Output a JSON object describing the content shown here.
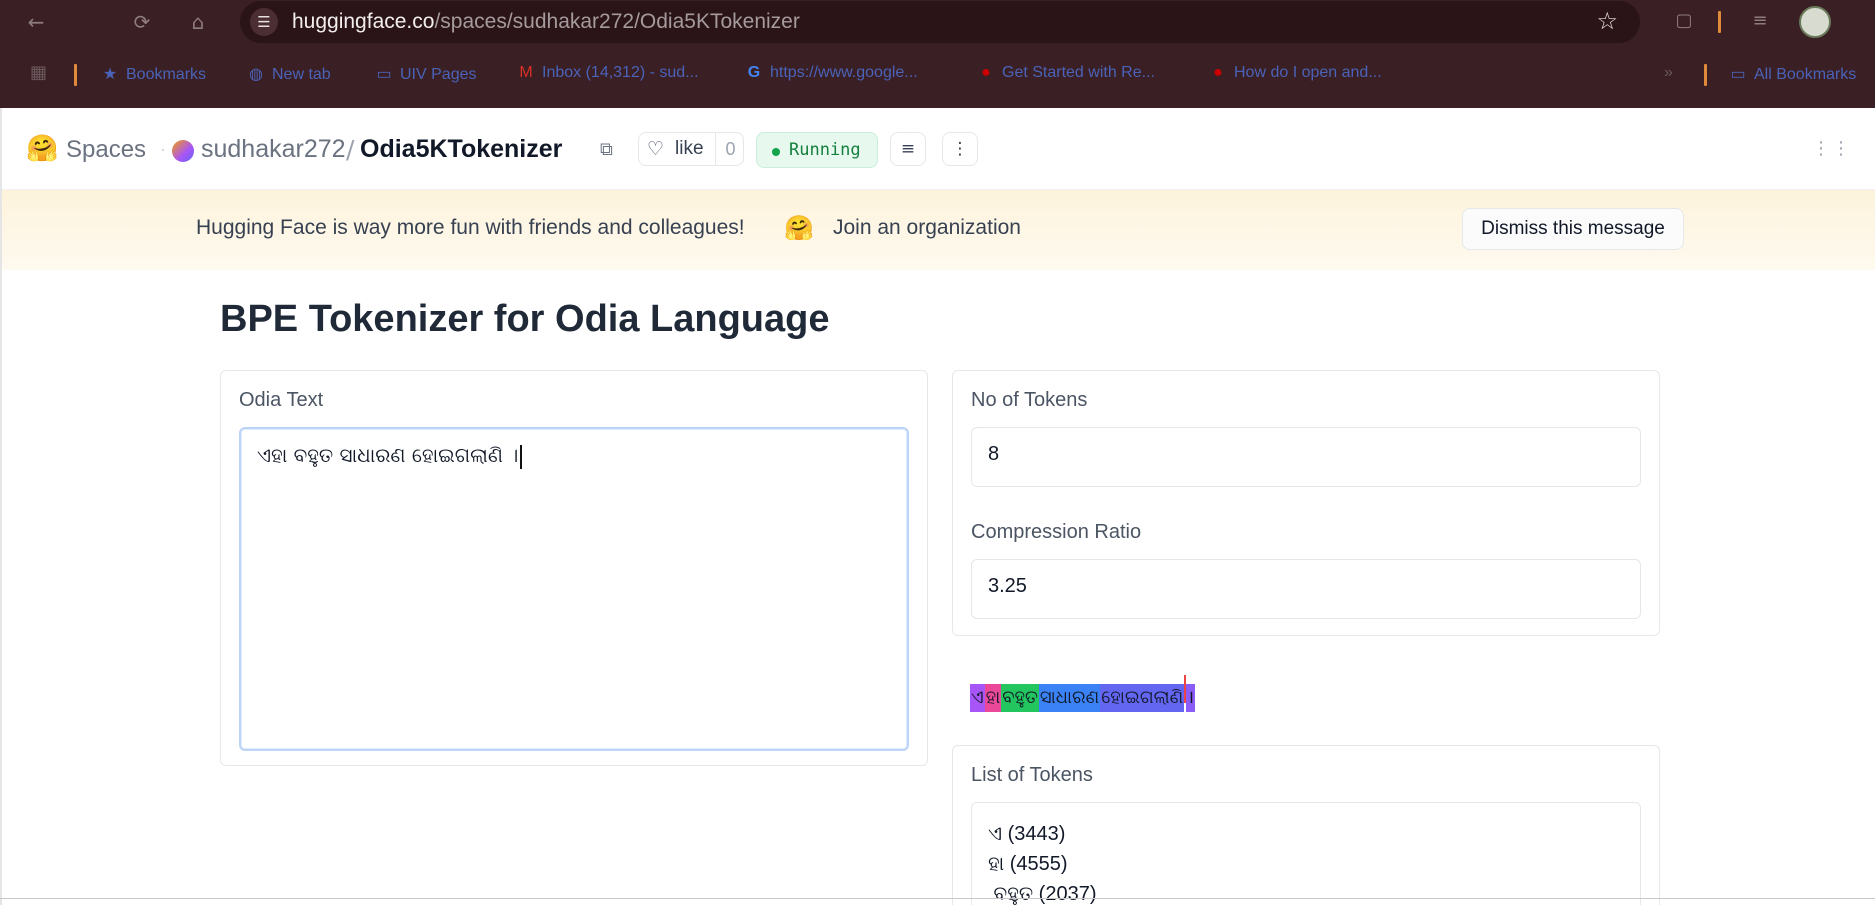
{
  "browser": {
    "url_host": "huggingface.co",
    "url_path": "/spaces/sudhakar272/Odia5KTokenizer",
    "bookmarks": [
      {
        "label": "Bookmarks",
        "icon": "star-icon"
      },
      {
        "label": "New tab",
        "icon": "globe-icon"
      },
      {
        "label": "UIV Pages",
        "icon": "folder-icon"
      },
      {
        "label": "Inbox (14,312) - sud...",
        "icon": "gmail-icon"
      },
      {
        "label": "https://www.google...",
        "icon": "google-icon"
      },
      {
        "label": "Get Started with Re...",
        "icon": "redhat-icon"
      },
      {
        "label": "How do I open and...",
        "icon": "redhat-icon"
      },
      {
        "label": "All Bookmarks",
        "icon": "folder-icon"
      }
    ]
  },
  "hf_header": {
    "spaces_label": "Spaces",
    "owner": "sudhakar272",
    "separator": "/",
    "repo": "Odia5KTokenizer",
    "like_label": "like",
    "like_count": "0",
    "status": "Running"
  },
  "banner": {
    "message": "Hugging Face is way more fun with friends and colleagues!",
    "emoji": "🤗",
    "join_link": "Join an organization",
    "dismiss_label": "Dismiss this message"
  },
  "app": {
    "title": "BPE Tokenizer for Odia Language",
    "input": {
      "label": "Odia Text",
      "value": "ଏହା ବହୁତ ସାଧାରଣ ହୋଇଗଲାଣି ।"
    },
    "num_tokens": {
      "label": "No of Tokens",
      "value": "8"
    },
    "compression_ratio": {
      "label": "Compression Ratio",
      "value": "3.25"
    },
    "token_visualization": [
      {
        "text": "ଏ",
        "color": "#a855f7"
      },
      {
        "text": "ହା",
        "color": "#ec4899"
      },
      {
        "text": " ବହୁତ",
        "color": "#22c55e"
      },
      {
        "text": " ସାଧାରଣ",
        "color": "#3b82f6"
      },
      {
        "text": " ହୋଇଗଲାଣି",
        "color": "#6366f1"
      },
      {
        "text": " ",
        "color": "#ef4444"
      },
      {
        "text": "।",
        "color": "#8b5cf6"
      }
    ],
    "token_list": {
      "label": "List of Tokens",
      "items": [
        "ଏ (3443)",
        "ହା (4555)",
        " ବହୁତ (2037)"
      ]
    }
  }
}
